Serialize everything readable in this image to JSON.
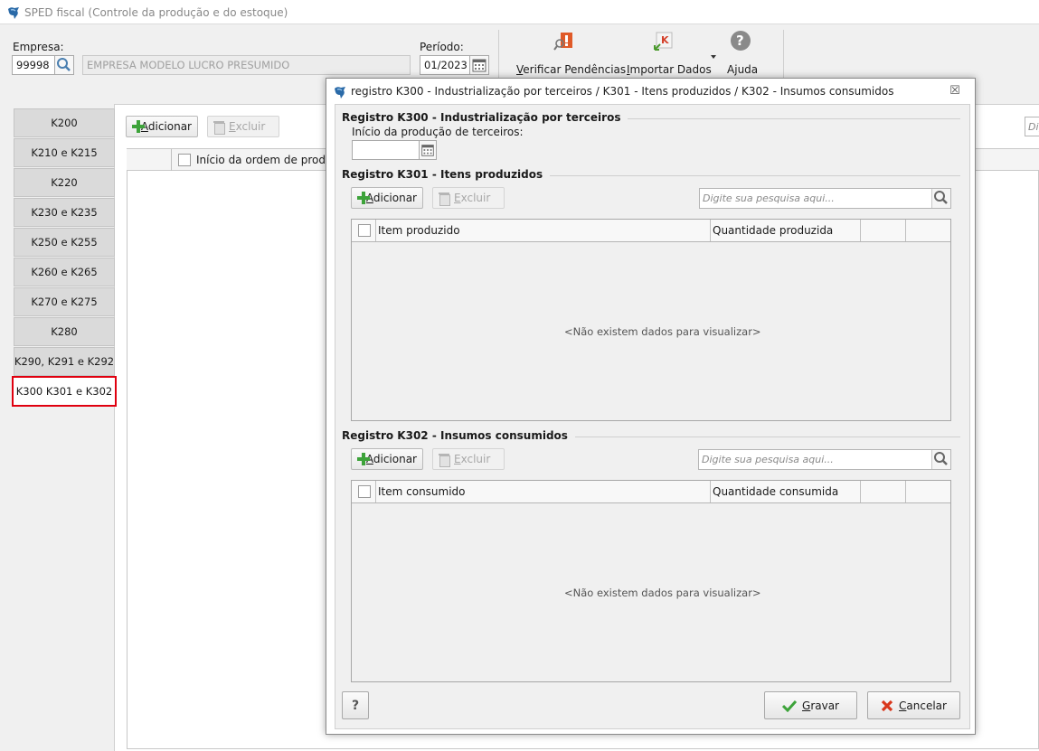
{
  "window": {
    "title": "SPED fiscal (Controle da produção e do estoque)"
  },
  "header": {
    "empresa_label": "Empresa:",
    "empresa_code": "99998",
    "empresa_name": "EMPRESA MODELO LUCRO PRESUMIDO",
    "periodo_label": "Período:",
    "periodo_value": "01/2023"
  },
  "toolbar": {
    "verificar": {
      "first": "V",
      "rest": "erificar Pendências"
    },
    "importar": {
      "first": "I",
      "rest": "mportar Dados"
    },
    "ajuda": {
      "pre": "A",
      "u": "j",
      "post": "uda"
    }
  },
  "tabs": [
    "K200",
    "K210 e K215",
    "K220",
    "K230 e K235",
    "K250 e K255",
    "K260 e K265",
    "K270 e K275",
    "K280",
    "K290, K291 e K292",
    "K300 K301 e K302"
  ],
  "main": {
    "add": {
      "first": "A",
      "rest": "dicionar"
    },
    "del": {
      "first": "E",
      "rest": "xcluir"
    },
    "col_inicio": "Início da ordem de produç",
    "search_partial": "Dig"
  },
  "dialog": {
    "title": "registro K300 - Industrialização por terceiros / K301 - Itens produzidos / K302 - Insumos consumidos",
    "close": "☒",
    "k300": {
      "title": "Registro K300 - Industrialização por terceiros",
      "field_label": "Início da produção de terceiros:",
      "field_value": ""
    },
    "k301": {
      "title": "Registro K301 - Itens produzidos",
      "add": {
        "first": "A",
        "rest": "dicionar"
      },
      "del": {
        "first": "E",
        "rest": "xcluir"
      },
      "search_placeholder": "Digite sua pesquisa aqui...",
      "columns": [
        "Item produzido",
        "Quantidade produzida"
      ],
      "empty": "<Não existem dados para visualizar>"
    },
    "k302": {
      "title": "Registro K302 - Insumos consumidos",
      "add": {
        "first": "A",
        "rest": "dicionar"
      },
      "del": {
        "first": "E",
        "rest": "xcluir"
      },
      "search_placeholder": "Digite sua pesquisa aqui...",
      "columns": [
        "Item consumido",
        "Quantidade consumida"
      ],
      "empty": "<Não existem dados para visualizar>"
    },
    "help": "?",
    "gravar": {
      "first": "G",
      "rest": "ravar"
    },
    "cancelar": {
      "first": "C",
      "rest": "ancelar"
    }
  },
  "colors": {
    "highlight": "#e0000f",
    "plus_green": "#3da33a",
    "cancel_red": "#d9371c"
  }
}
